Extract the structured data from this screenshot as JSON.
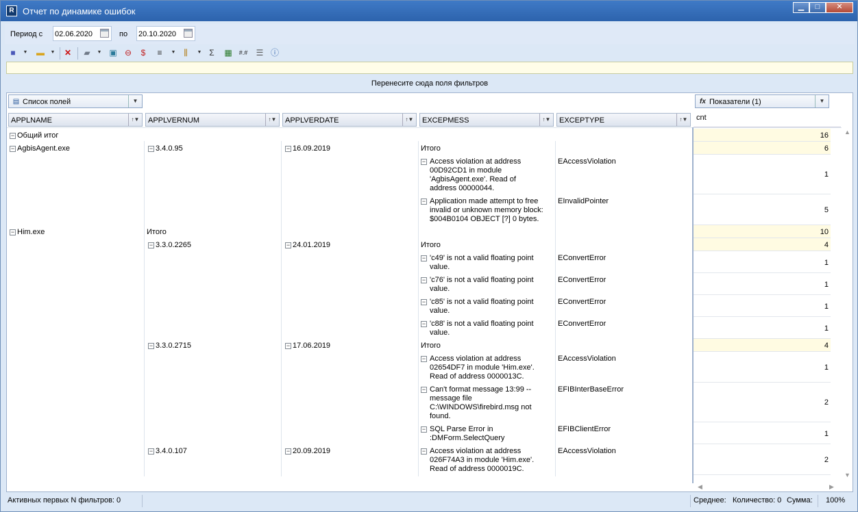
{
  "window": {
    "title": "Отчет по динамике ошибок",
    "app_icon_letter": "R"
  },
  "params": {
    "period_from_label": "Период с",
    "date_from": "02.06.2020",
    "period_to_label": "по",
    "date_to": "20.10.2020"
  },
  "toolbar": {
    "icons": [
      "save-icon",
      "open-folder-icon",
      "delete-icon",
      "export-icon",
      "refresh-icon",
      "strike-icon",
      "strike-dollar-icon",
      "sort-icon",
      "columns-icon",
      "chart-icon",
      "sum-icon",
      "grid-icon",
      "format-icon",
      "filter-icon",
      "info-icon"
    ]
  },
  "filter_drop": "Перенесите сюда поля фильтров",
  "pivot": {
    "field_list_label": "Список полей",
    "measures_label": "Показатели (1)",
    "measure_field": "cnt",
    "columns": [
      "APPLNAME",
      "APPLVERNUM",
      "APPLVERDATE",
      "EXCEPMESS",
      "EXCEPTYPE"
    ],
    "grand_total_label": "Общий итог",
    "total_label": "Итого",
    "apps": [
      {
        "name": "AgbisAgent.exe",
        "versions": [
          {
            "ver": "3.4.0.95",
            "date": "16.09.2019",
            "errors": [
              {
                "msg": "Access violation at address 00D92CD1 in module 'AgbisAgent.exe'. Read of address 00000044.",
                "type": "EAccessViolation",
                "cnt": "1"
              },
              {
                "msg": "Application made attempt to free invalid or unknown memory block: $004B0104 OBJECT [?] 0 bytes.",
                "type": "EInvalidPointer",
                "cnt": "5"
              }
            ]
          }
        ]
      },
      {
        "name": "Him.exe",
        "versions": [
          {
            "ver": "3.3.0.2265",
            "date": "24.01.2019",
            "errors": [
              {
                "msg": "'c49' is not a valid floating point value.",
                "type": "EConvertError",
                "cnt": "1"
              },
              {
                "msg": "'c76' is not a valid floating point value.",
                "type": "EConvertError",
                "cnt": "1"
              },
              {
                "msg": "'c85' is not a valid floating point value.",
                "type": "EConvertError",
                "cnt": "1"
              },
              {
                "msg": "'c88' is not a valid floating point value.",
                "type": "EConvertError",
                "cnt": "1"
              }
            ]
          },
          {
            "ver": "3.3.0.2715",
            "date": "17.06.2019",
            "errors": [
              {
                "msg": "Access violation at address 02654DF7 in module 'Him.exe'. Read of address 0000013C.",
                "type": "EAccessViolation",
                "cnt": "1"
              },
              {
                "msg": "Can't format message 13:99 -- message file C:\\WINDOWS\\firebird.msg not found.",
                "type": "EFIBInterBaseError",
                "cnt": "2"
              },
              {
                "msg": "SQL Parse Error in :DMForm.SelectQuery",
                "type": "EFIBClientError",
                "cnt": "1"
              }
            ]
          },
          {
            "ver": "3.4.0.107",
            "date": "20.09.2019",
            "errors": [
              {
                "msg": "Access violation at address 026F74A3 in module 'Him.exe'. Read of address 0000019C.",
                "type": "EAccessViolation",
                "cnt": "2"
              }
            ]
          }
        ]
      }
    ],
    "values": {
      "grand_total": "16",
      "agbis_total": "6",
      "agbis_v1_cells": [
        "1",
        "5"
      ],
      "him_total": "10",
      "him_v1_total": "4",
      "him_v2_total": "4"
    }
  },
  "status": {
    "active_filters": "Активных первых N фильтров: 0",
    "average": "Среднее:",
    "count": "Количество: 0",
    "sum": "Сумма:",
    "zoom": "100%"
  }
}
